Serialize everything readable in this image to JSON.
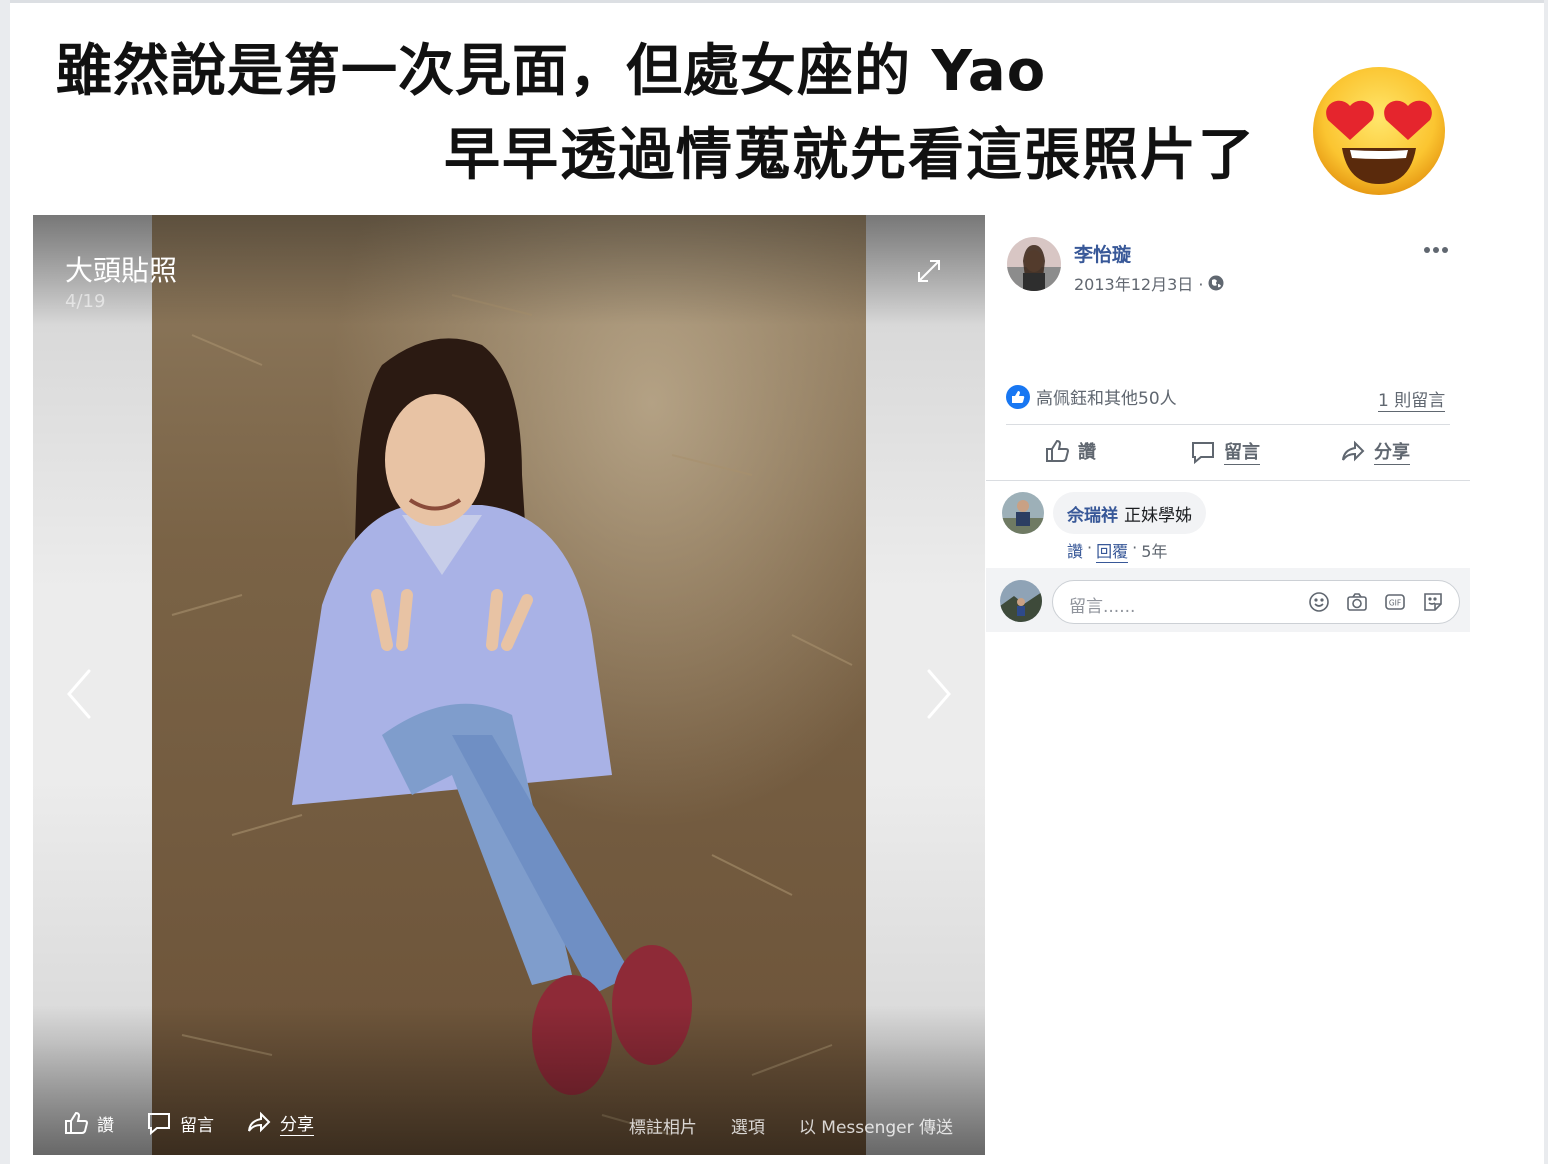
{
  "caption": {
    "line1": "雖然說是第一次見面，但處女座的 Yao",
    "line2": "早早透過情蒐就先看這張照片了"
  },
  "viewer": {
    "album_title": "大頭貼照",
    "photo_index": "4/19",
    "actions": {
      "like": "讚",
      "comment": "留言",
      "share": "分享"
    },
    "options": {
      "tag": "標註相片",
      "options": "選項",
      "send": "以 Messenger 傳送"
    }
  },
  "post": {
    "author": "李怡璇",
    "date": "2013年12月3日 ·",
    "reactions_text": "高佩鈺和其他50人",
    "comment_count": "1 則留言",
    "actions": {
      "like": "讚",
      "comment": "留言",
      "share": "分享"
    }
  },
  "comment": {
    "author": "佘瑞祥",
    "text": "正妹學姊",
    "like": "讚",
    "sep1": "·",
    "reply": "回覆",
    "sep2": "·",
    "age": "5年"
  },
  "composer": {
    "placeholder": "留言......"
  },
  "colors": {
    "link": "#385898",
    "muted": "#606770",
    "like_blue": "#1877f2"
  }
}
